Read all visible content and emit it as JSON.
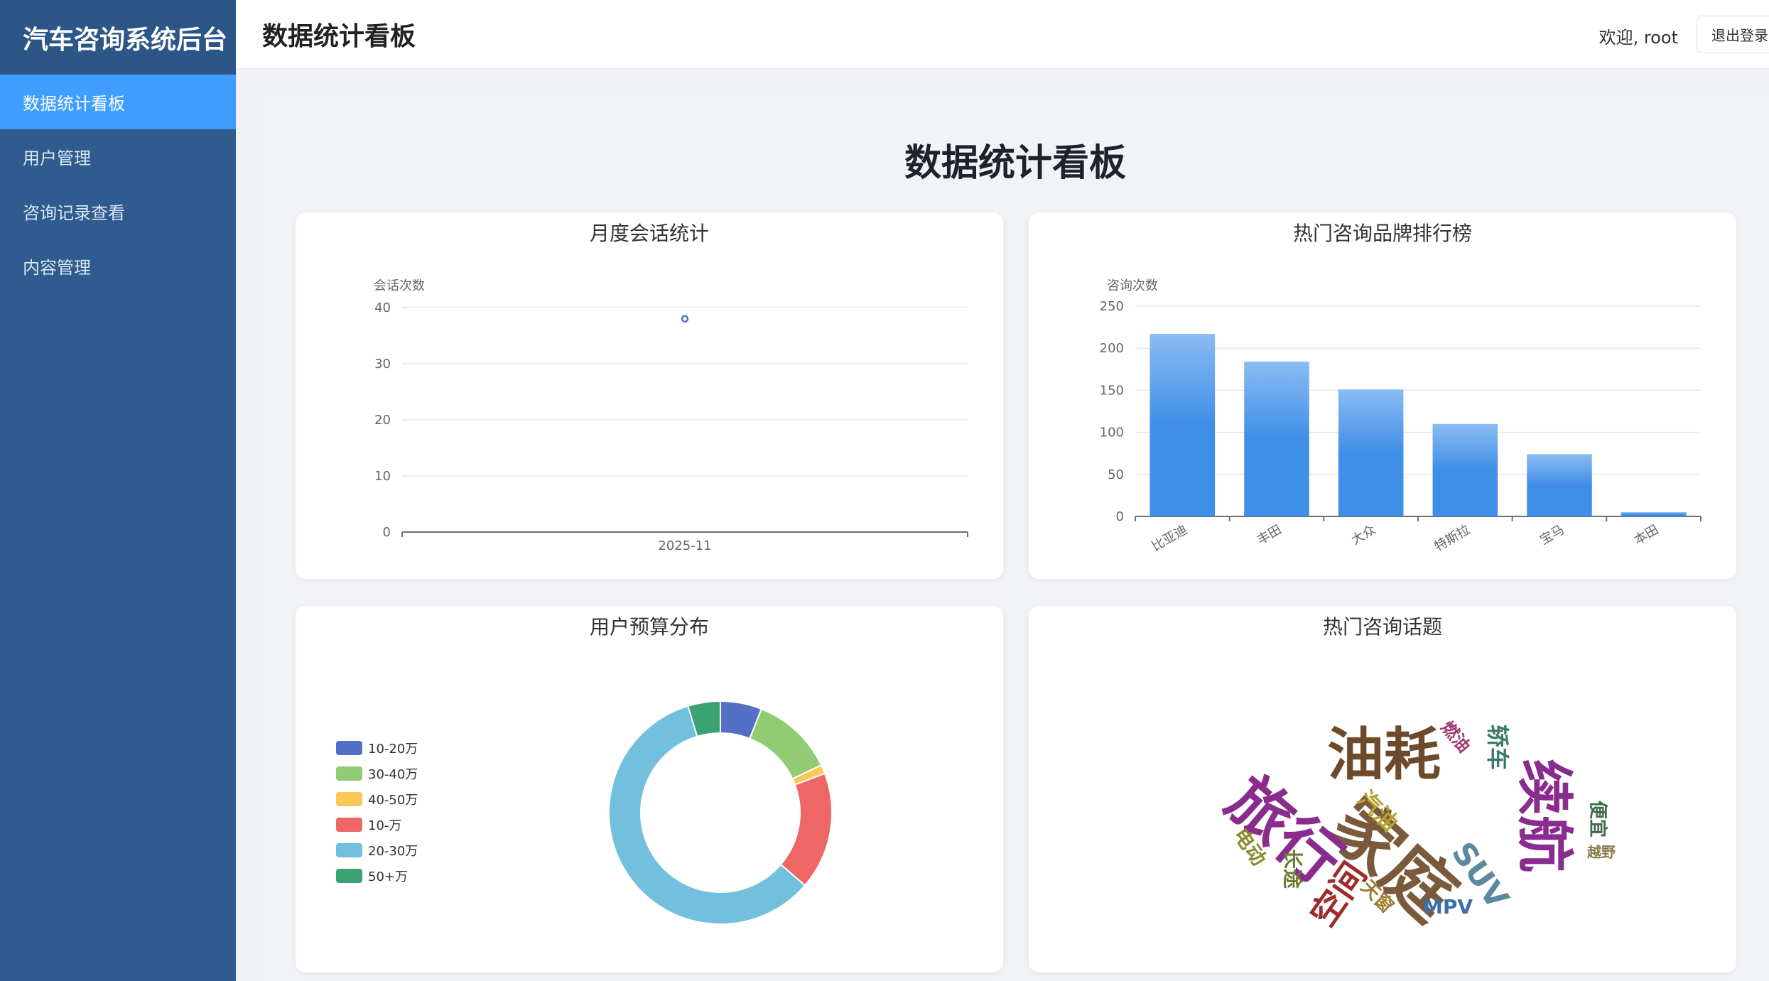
{
  "sidebar": {
    "brand": "汽车咨询系统后台",
    "items": [
      {
        "label": "数据统计看板",
        "active": true
      },
      {
        "label": "用户管理",
        "active": false
      },
      {
        "label": "咨询记录查看",
        "active": false
      },
      {
        "label": "内容管理",
        "active": false
      }
    ]
  },
  "header": {
    "title": "数据统计看板",
    "welcome": "欢迎, root",
    "logout_label": "退出登录"
  },
  "main": {
    "title": "数据统计看板"
  },
  "colors": {
    "sidebar_bg": "#2f5b8e",
    "active_item": "#409eff",
    "bar": "#3f8ee8"
  },
  "chart_data": [
    {
      "type": "line",
      "title": "月度会话统计",
      "ylabel": "会话次数",
      "categories": [
        "2025-11"
      ],
      "values": [
        38
      ],
      "ylim": [
        0,
        40
      ],
      "yticks": [
        0,
        10,
        20,
        30,
        40
      ],
      "grid": true
    },
    {
      "type": "bar",
      "title": "热门咨询品牌排行榜",
      "ylabel": "咨询次数",
      "categories": [
        "比亚迪",
        "丰田",
        "大众",
        "特斯拉",
        "宝马",
        "本田"
      ],
      "values": [
        217,
        184,
        151,
        110,
        74,
        5
      ],
      "ylim": [
        0,
        250
      ],
      "yticks": [
        0,
        50,
        100,
        150,
        200,
        250
      ],
      "grid": true
    },
    {
      "type": "pie",
      "title": "用户预算分布",
      "legend_position": "left",
      "slices": [
        {
          "label": "10-20万",
          "value": 6,
          "color": "#5470c6"
        },
        {
          "label": "30-40万",
          "value": 12,
          "color": "#91cc75"
        },
        {
          "label": "40-50万",
          "value": 1.3,
          "color": "#fac858"
        },
        {
          "label": "10-万",
          "value": 17,
          "color": "#ee6666"
        },
        {
          "label": "20-30万",
          "value": 59,
          "color": "#73c0de"
        },
        {
          "label": "50+万",
          "value": 4.7,
          "color": "#3ba272"
        }
      ]
    },
    {
      "type": "wordcloud",
      "title": "热门咨询话题",
      "words": [
        {
          "text": "家庭",
          "color": "#7b5a3c"
        },
        {
          "text": "旅行",
          "color": "#8a2c8e"
        },
        {
          "text": "油耗",
          "color": "#6d4a2a"
        },
        {
          "text": "续航",
          "color": "#8a2c8e"
        },
        {
          "text": "空间",
          "color": "#9e2b2b"
        },
        {
          "text": "SUV",
          "color": "#5a8a9e"
        },
        {
          "text": "MPV",
          "color": "#3d6ea8"
        },
        {
          "text": "汽油",
          "color": "#b8a22e"
        },
        {
          "text": "轿车",
          "color": "#3c7a6a"
        },
        {
          "text": "燃油",
          "color": "#9e3a6e"
        },
        {
          "text": "电动",
          "color": "#8a8a2e"
        },
        {
          "text": "长途",
          "color": "#6a7a2e"
        },
        {
          "text": "天窗",
          "color": "#9e7a2e"
        },
        {
          "text": "便宜",
          "color": "#3c6a4a"
        },
        {
          "text": "越野",
          "color": "#8a7a4a"
        }
      ]
    }
  ]
}
